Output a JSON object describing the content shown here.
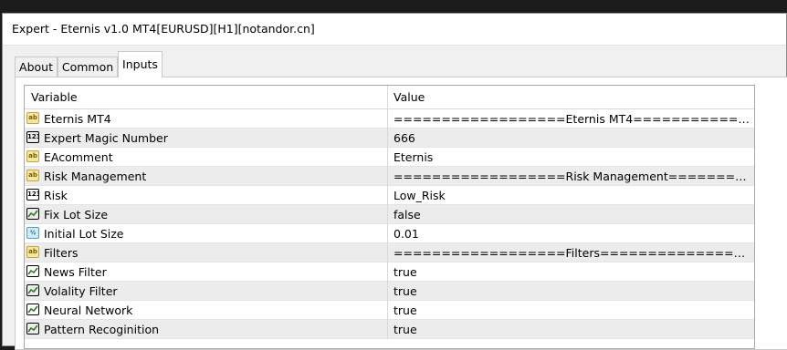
{
  "window": {
    "title": "Expert - Eternis v1.0 MT4[EURUSD][H1][notandor.cn]"
  },
  "tabs": [
    {
      "label": "About"
    },
    {
      "label": "Common"
    },
    {
      "label": "Inputs"
    }
  ],
  "active_tab": "Inputs",
  "grid": {
    "columns": {
      "variable": "Variable",
      "value": "Value"
    },
    "rows": [
      {
        "icon": "text-type-icon",
        "icon_glyph": "ab",
        "variable": "Eternis MT4",
        "value": "==================Eternis MT4===============..."
      },
      {
        "icon": "integer-type-icon",
        "icon_glyph": "123",
        "variable": "Expert Magic Number",
        "value": "666"
      },
      {
        "icon": "text-type-icon",
        "icon_glyph": "ab",
        "variable": "EAcomment",
        "value": "Eternis"
      },
      {
        "icon": "text-type-icon",
        "icon_glyph": "ab",
        "variable": "Risk Management",
        "value": "==================Risk Management============..."
      },
      {
        "icon": "integer-type-icon",
        "icon_glyph": "123",
        "variable": "Risk",
        "value": "Low_Risk"
      },
      {
        "icon": "boolean-type-icon",
        "icon_glyph": "",
        "variable": "Fix Lot Size",
        "value": "false"
      },
      {
        "icon": "double-type-icon",
        "icon_glyph": "½",
        "variable": "Initial Lot Size",
        "value": "0.01"
      },
      {
        "icon": "text-type-icon",
        "icon_glyph": "ab",
        "variable": "Filters",
        "value": "==================Filters=================="
      },
      {
        "icon": "boolean-type-icon",
        "icon_glyph": "",
        "variable": "News Filter",
        "value": "true"
      },
      {
        "icon": "boolean-type-icon",
        "icon_glyph": "",
        "variable": "Volality Filter",
        "value": "true"
      },
      {
        "icon": "boolean-type-icon",
        "icon_glyph": "",
        "variable": "Neural Network",
        "value": "true"
      },
      {
        "icon": "boolean-type-icon",
        "icon_glyph": "",
        "variable": "Pattern Recoginition",
        "value": "true"
      }
    ]
  }
}
